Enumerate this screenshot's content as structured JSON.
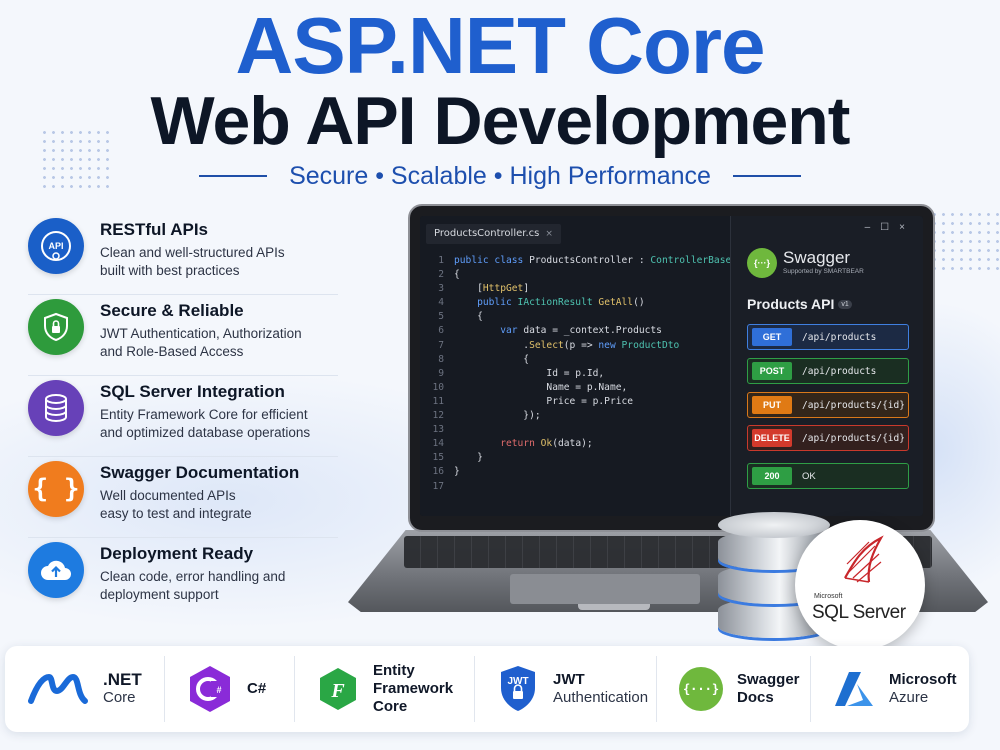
{
  "header": {
    "title_line1": "ASP.NET Core",
    "title_line2": "Web API Development",
    "tagline": "Secure • Scalable • High Performance"
  },
  "colors": {
    "primary_blue": "#1f5fce",
    "dark_text": "#0d1626",
    "feature_icon_colors": [
      "#1a5fc8",
      "#2e9b3c",
      "#6741b8",
      "#f07c1e",
      "#1e7be0"
    ]
  },
  "features": [
    {
      "icon": "api-gear-icon",
      "title": "RESTful APIs",
      "desc1": "Clean and well-structured APIs",
      "desc2": "built with best practices"
    },
    {
      "icon": "shield-lock-icon",
      "title": "Secure & Reliable",
      "desc1": "JWT Authentication, Authorization",
      "desc2": "and Role-Based Access"
    },
    {
      "icon": "database-icon",
      "title": "SQL Server Integration",
      "desc1": "Entity Framework Core for efficient",
      "desc2": "and optimized database operations"
    },
    {
      "icon": "curly-braces-icon",
      "title": "Swagger Documentation",
      "desc1": "Well documented APIs",
      "desc2": "easy to test and integrate"
    },
    {
      "icon": "cloud-upload-icon",
      "title": "Deployment Ready",
      "desc1": "Clean code, error handling and",
      "desc2": "deployment support"
    }
  ],
  "editor": {
    "tab_label": "ProductsController.cs",
    "lines": [
      "1",
      "2",
      "3",
      "4",
      "5",
      "6",
      "7",
      "8",
      "9",
      "10",
      "11",
      "12",
      "13",
      "14",
      "15",
      "16",
      "17"
    ]
  },
  "swagger": {
    "logo_text": "{···}",
    "brand": "Swagger",
    "supported_by": "Supported by SMARTBEAR",
    "api_title": "Products API",
    "api_version": "v1",
    "endpoints": [
      {
        "method": "GET",
        "path": "/api/products",
        "color": "#2f6fd8",
        "border": "#3f7fe0",
        "bg": "#1c2a44"
      },
      {
        "method": "POST",
        "path": "/api/products",
        "color": "#2e9e44",
        "border": "#2f9e46",
        "bg": "#1a2e22"
      },
      {
        "method": "PUT",
        "path": "/api/products/{id}",
        "color": "#e07a14",
        "border": "#d9781a",
        "bg": "#33261a"
      },
      {
        "method": "DELETE",
        "path": "/api/products/{id}",
        "color": "#d33a2c",
        "border": "#c9392c",
        "bg": "#33201e"
      },
      {
        "method": "200",
        "path": "OK",
        "color": "#2e9e44",
        "border": "#2f9e46",
        "bg": "#1a2e22"
      }
    ]
  },
  "sql_server": {
    "vendor": "Microsoft",
    "name": "SQL Server"
  },
  "tech_stack": [
    {
      "icon": "dotnet-logo-icon",
      "line1": ".NET",
      "line2": "Core"
    },
    {
      "icon": "csharp-logo-icon",
      "line1": "C#",
      "line2": ""
    },
    {
      "icon": "entity-framework-icon",
      "line1": "Entity",
      "line2": "Framework",
      "line3": "Core"
    },
    {
      "icon": "jwt-shield-icon",
      "line1": "JWT",
      "line2": "Authentication"
    },
    {
      "icon": "swagger-logo-icon",
      "line1": "Swagger",
      "line2": "Docs"
    },
    {
      "icon": "azure-logo-icon",
      "line1": "Microsoft",
      "line2": "Azure"
    }
  ]
}
